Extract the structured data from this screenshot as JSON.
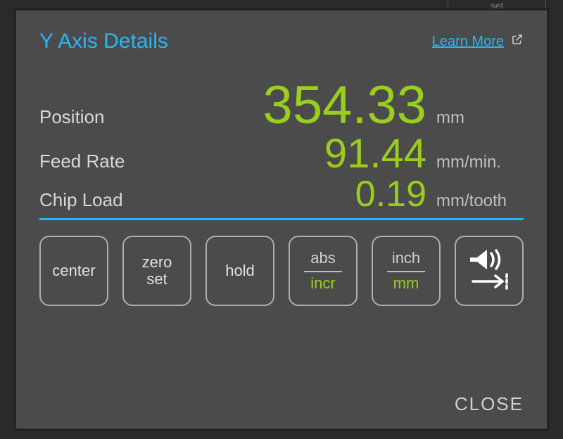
{
  "bg_artifact": "set",
  "header": {
    "title": "Y Axis Details",
    "learn_more": "Learn More"
  },
  "rows": {
    "position": {
      "label": "Position",
      "value": "354.33",
      "unit": "mm"
    },
    "feed_rate": {
      "label": "Feed Rate",
      "value": "91.44",
      "unit": "mm/min."
    },
    "chip_load": {
      "label": "Chip Load",
      "value": "0.19",
      "unit": "mm/tooth"
    }
  },
  "buttons": {
    "center": {
      "label": "center"
    },
    "zero_set": {
      "line1": "zero",
      "line2": "set"
    },
    "hold": {
      "label": "hold"
    },
    "mode": {
      "opt1": "abs",
      "opt2": "incr",
      "active": "opt2"
    },
    "units": {
      "opt1": "inch",
      "opt2": "mm",
      "active": "opt2"
    }
  },
  "footer": {
    "close": "CLOSE"
  }
}
